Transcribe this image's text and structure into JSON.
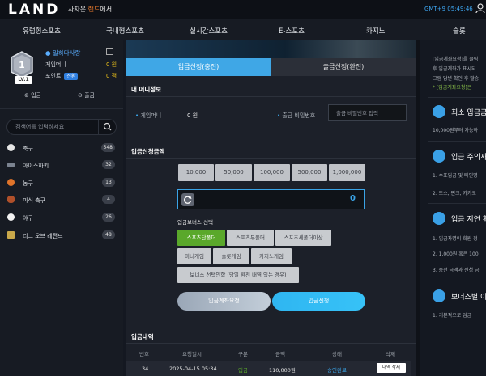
{
  "brand": {
    "logo": "LAND",
    "tagline_pre": "사자은 ",
    "tagline_hl": "랜드",
    "tagline_post": "에서",
    "timezone": "GMT+9 05:49:46"
  },
  "nav": [
    "유럽형스포츠",
    "국내형스포츠",
    "실시간스포츠",
    "E-스포츠",
    "카지노",
    "슬롯"
  ],
  "profile": {
    "level_number": "1",
    "level_label": "LV.1",
    "username": "일하다사랑",
    "money_label": "게임머니",
    "money_value": "0 원",
    "point_label": "포인트",
    "point_convert": "전환",
    "point_value": "0 점",
    "deposit_label": "입금",
    "withdraw_label": "출금"
  },
  "search": {
    "placeholder": "검색어를 입력하세요"
  },
  "sports": [
    {
      "name": "축구",
      "count": "548"
    },
    {
      "name": "아이스하키",
      "count": "32"
    },
    {
      "name": "농구",
      "count": "13"
    },
    {
      "name": "미식 축구",
      "count": "4"
    },
    {
      "name": "야구",
      "count": "26"
    },
    {
      "name": "리그 오브 레전드",
      "count": "48"
    }
  ],
  "tabs": {
    "deposit": "입금신청(충전)",
    "withdraw": "출금신청(환전)"
  },
  "myinfo": {
    "title": "내 머니정보",
    "money_label": "게임머니",
    "money_value": "0 원",
    "pw_label": "출금 비밀번호",
    "pw_placeholder": "출금 비밀번호 입력"
  },
  "deposit": {
    "title": "입금신청금액",
    "amounts": [
      "10,000",
      "50,000",
      "100,000",
      "500,000",
      "1,000,000"
    ],
    "current": "0",
    "bonus_title": "입금보너스 선택",
    "bonus_row1": [
      "스포츠단폴더",
      "스포츠두폴더",
      "스포츠세폴더이상"
    ],
    "bonus_row2": [
      "미니게임",
      "슬롯게임",
      "카지노게임"
    ],
    "bonus_none": "보너스 선택안함 (당일 환전 내역 있는 경우)",
    "btn_request": "입금계좌요청",
    "btn_apply": "입금신청"
  },
  "history": {
    "title": "입금내역",
    "headers": [
      "번호",
      "요청일시",
      "구분",
      "금액",
      "상태",
      "삭제"
    ],
    "rows": [
      {
        "no": "34",
        "date": "2025-04-15 05:34",
        "type": "입금",
        "amount": "110,000원",
        "status": "승인완료",
        "delete": "내역 삭제"
      }
    ]
  },
  "right_panel": {
    "l1": "[입금계좌요청]을 클릭",
    "l2": "후 입금계좌가 표시되",
    "l3": "그럼 답변 확인 후 발송",
    "l4": "* [입금계좌요청]은",
    "h1": "최소 입금금",
    "t1": "10,000원부터 가능하",
    "h2": "입금 주의사",
    "t2a": "1. 수표입금 및 타인명",
    "t2b": "2. 토스, 핀크, 카카오",
    "h3": "입금 지연 확",
    "t3a": "1. 입금자명이 회원 정",
    "t3b": "2. 1,000원 혹은 100",
    "t3c": "3. 충전 금액과 신청 금",
    "h4": "보너스별 이",
    "t4": "1. 기본적으로 입금"
  },
  "colors": {
    "accent": "#3fa7e6",
    "green": "#5aa82b",
    "highlight": "#f07d2d"
  }
}
